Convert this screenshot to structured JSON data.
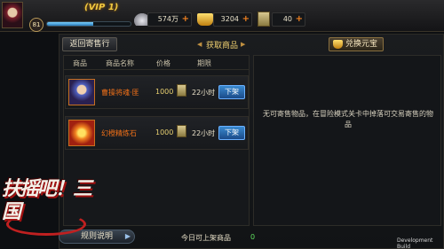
{
  "top_bar": {
    "level": "81",
    "vip": "(VIP 1)",
    "exp_fraction": 0.55,
    "silver": "574万",
    "gold": "3204",
    "tickets": "40",
    "plus_glyph": "+"
  },
  "header": {
    "back_label": "返回寄售行",
    "title": "获取商品",
    "exchange_label": "兑换元宝"
  },
  "table": {
    "columns": [
      "商品",
      "商品名称",
      "价格",
      "期限"
    ],
    "rows": [
      {
        "name": "曹操将魂·匪",
        "price": "1000",
        "time": "22小时",
        "action": "下架",
        "icon": "general-portrait-icon"
      },
      {
        "name": "幻橙精炼石",
        "price": "1000",
        "time": "22小时",
        "action": "下架",
        "icon": "refine-stone-icon"
      }
    ]
  },
  "right_panel": {
    "empty_message": "无可寄售物品，在冒险模式关卡中掉落可交易寄售的物品"
  },
  "bottom": {
    "rules_label": "规则说明",
    "today_label": "今日可上架商品",
    "today_value": "0",
    "build_label": "Development Build"
  },
  "logo": {
    "text": "扶摇吧！三国"
  },
  "colors": {
    "accent_gold": "#f0c840",
    "item_name": "#f07018",
    "button_blue": "#2a6ab0"
  }
}
